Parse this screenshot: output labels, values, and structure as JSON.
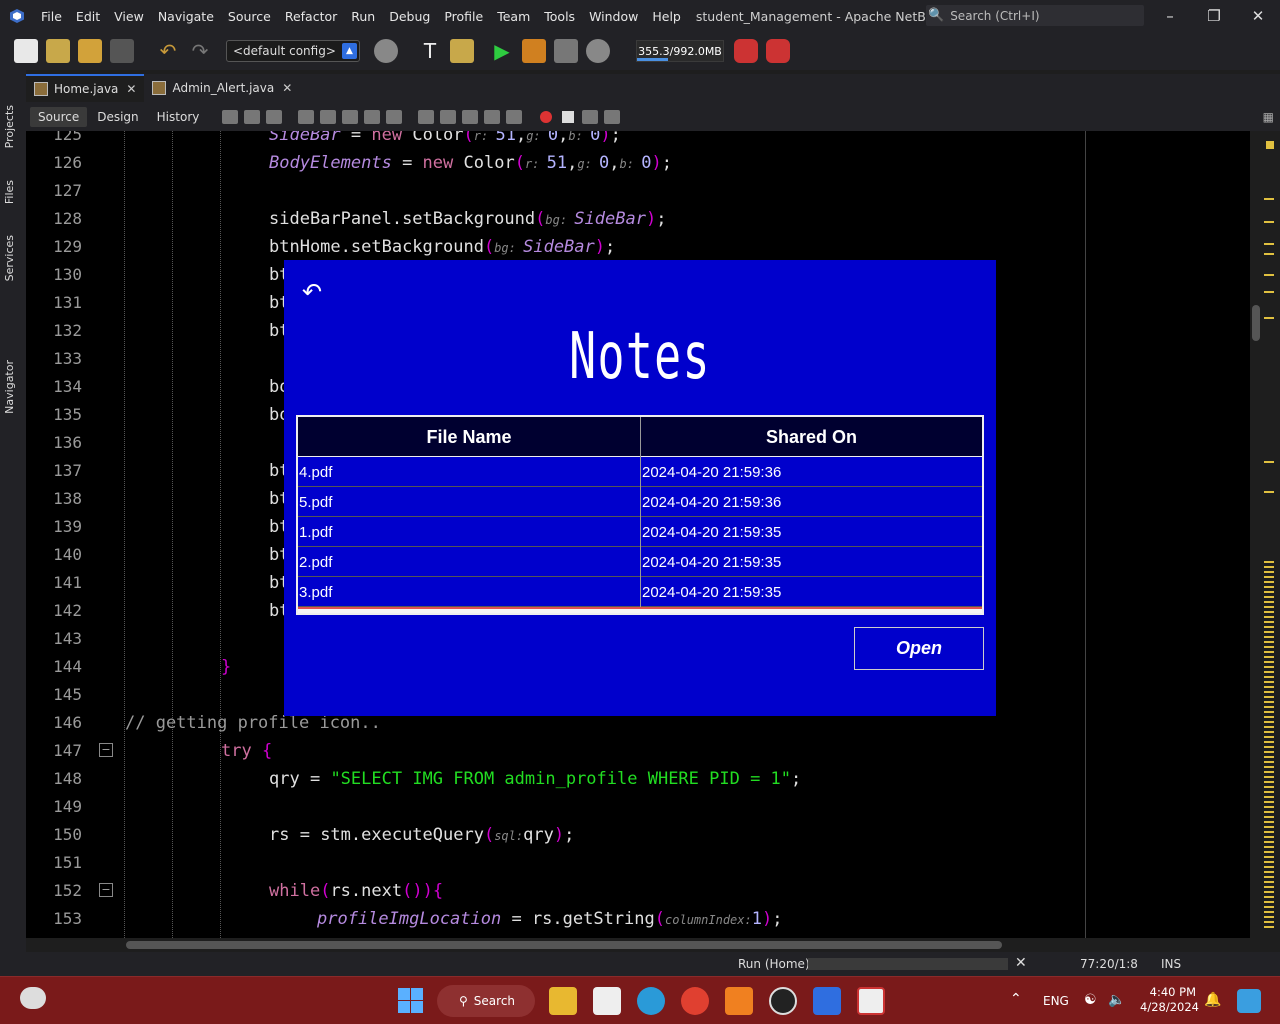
{
  "window": {
    "title": "student_Management - Apache NetBeans IDE ...",
    "search_placeholder": "Search (Ctrl+I)",
    "menu": [
      "File",
      "Edit",
      "View",
      "Navigate",
      "Source",
      "Refactor",
      "Run",
      "Debug",
      "Profile",
      "Team",
      "Tools",
      "Window",
      "Help"
    ]
  },
  "toolbar": {
    "config": "<default config>",
    "memory": "355.3/992.0MB",
    "memory_fraction": 0.358
  },
  "side_tabs": [
    "Projects",
    "Files",
    "Services",
    "Navigator"
  ],
  "editor_tabs": [
    {
      "label": "Home.java",
      "active": true
    },
    {
      "label": "Admin_Alert.java",
      "active": false
    }
  ],
  "view_tabs": [
    "Source",
    "Design",
    "History"
  ],
  "code": {
    "line_numbers": [
      "125",
      "126",
      "127",
      "128",
      "129",
      "130",
      "131",
      "132",
      "133",
      "134",
      "135",
      "136",
      "137",
      "138",
      "139",
      "140",
      "141",
      "142",
      "143",
      "144",
      "145",
      "146",
      "147",
      "148",
      "149",
      "150",
      "151",
      "152",
      "153"
    ],
    "l125_var": "SideBar",
    "l126_var": "BodyElements",
    "l128_obj": "sideBarPanel",
    "l129_obj": "btnHome",
    "l146_comment": "// getting profile icon..",
    "l147_kw": "try",
    "l148_str": "\"SELECT IMG FROM admin_profile WHERE PID = 1\"",
    "l150_call": "stm.executeQuery",
    "l153_var": "profileImgLocation"
  },
  "dialog": {
    "title": "Notes",
    "columns": [
      "File Name",
      "Shared On"
    ],
    "rows": [
      [
        "4.pdf",
        "2024-04-20 21:59:36"
      ],
      [
        "5.pdf",
        "2024-04-20 21:59:36"
      ],
      [
        "1.pdf",
        "2024-04-20 21:59:35"
      ],
      [
        "2.pdf",
        "2024-04-20 21:59:35"
      ],
      [
        "3.pdf",
        "2024-04-20 21:59:35"
      ]
    ],
    "open_label": "Open",
    "colors": {
      "background": "#0000cc",
      "header": "#000030"
    }
  },
  "status": {
    "task": "Run (Home)",
    "position": "77:20/1:8",
    "mode": "INS"
  },
  "taskbar": {
    "search_label": "Search",
    "lang": "ENG",
    "time": "4:40 PM",
    "date": "4/28/2024"
  }
}
